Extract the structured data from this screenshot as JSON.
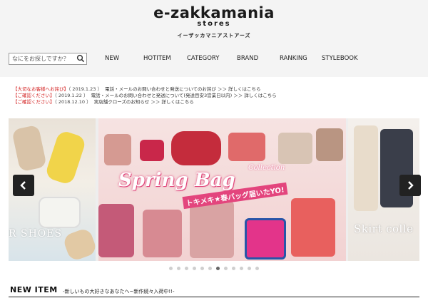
{
  "header": {
    "logo_main": "e-zakkamania",
    "logo_sub": "stores",
    "logo_jp": "イーザッカマニアストアーズ"
  },
  "search": {
    "placeholder": "なにをお探しですか？",
    "icon": "search-icon"
  },
  "nav": [
    "NEW",
    "HOTITEM",
    "CATEGORY",
    "BRAND",
    "RANKING",
    "STYLEBOOK"
  ],
  "notices": [
    {
      "tag": "【大切なお客様へお詫び】",
      "date": "（ 2019.1.23 ）",
      "msg": "電話・メールのお問い合わせと発送についてのお詫び ＞＞ 詳しくはこちら"
    },
    {
      "tag": "【ご確認ください】",
      "date": "（ 2019.1.22 ）",
      "msg": "電話・メールのお問い合わせと発送について(発送目安3営業日以内) ＞＞ 詳しくはこちら"
    },
    {
      "tag": "【ご確認ください】",
      "date": "（ 2018.12.10 ）",
      "msg": "実店舗クローズのお知らせ ＞＞ 詳しくはこちら"
    }
  ],
  "slider": {
    "left_caption": "R SHOES",
    "banner_title": "Spring Bag",
    "banner_collection": "Collection",
    "banner_sub": "トキメキ★春バッグ届いたYO!",
    "right_caption": "Skirt colle",
    "dot_count": 12,
    "active_dot": 6,
    "accent": "#e3457d"
  },
  "new_item": {
    "title": "NEW ITEM",
    "subtitle": "-新しいもの大好きなあなたへ~新作続々入荷中!!-"
  }
}
